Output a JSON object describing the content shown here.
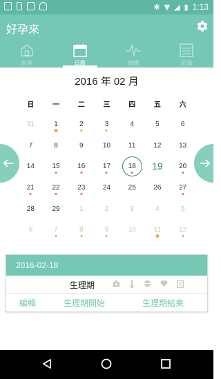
{
  "app": {
    "title": "好孕來"
  },
  "status": {
    "time": "1:13"
  },
  "tabs": [
    {
      "label": "首頁",
      "icon": "home-icon"
    },
    {
      "label": "日曆",
      "icon": "calendar-icon"
    },
    {
      "label": "曲線",
      "icon": "chart-line-icon"
    },
    {
      "label": "紀錄",
      "icon": "record-list-icon"
    }
  ],
  "calendar": {
    "title": "2016 年 02 月",
    "weekdays": [
      "日",
      "一",
      "二",
      "三",
      "四",
      "五",
      "六"
    ],
    "days": [
      {
        "d": "31",
        "other": true,
        "dot": "none"
      },
      {
        "d": "1",
        "other": false,
        "dot": "yellow-big"
      },
      {
        "d": "2",
        "other": false,
        "dot": "yellow"
      },
      {
        "d": "3",
        "other": false,
        "dot": "yellow"
      },
      {
        "d": "4",
        "other": false,
        "dot": "none"
      },
      {
        "d": "5",
        "other": false,
        "dot": "none"
      },
      {
        "d": "6",
        "other": false,
        "dot": "none"
      },
      {
        "d": "7",
        "other": false,
        "dot": "none"
      },
      {
        "d": "8",
        "other": false,
        "dot": "none"
      },
      {
        "d": "9",
        "other": false,
        "dot": "none"
      },
      {
        "d": "10",
        "other": false,
        "dot": "none"
      },
      {
        "d": "11",
        "other": false,
        "dot": "none"
      },
      {
        "d": "12",
        "other": false,
        "dot": "none"
      },
      {
        "d": "13",
        "other": false,
        "dot": "none"
      },
      {
        "d": "14",
        "other": false,
        "dot": "none"
      },
      {
        "d": "15",
        "other": false,
        "dot": "red"
      },
      {
        "d": "16",
        "other": false,
        "dot": "red"
      },
      {
        "d": "17",
        "other": false,
        "dot": "red"
      },
      {
        "d": "18",
        "other": false,
        "dot": "red",
        "selected": true
      },
      {
        "d": "19",
        "other": false,
        "dot": "none",
        "today": true
      },
      {
        "d": "20",
        "other": false,
        "dot": "red"
      },
      {
        "d": "21",
        "other": false,
        "dot": "red"
      },
      {
        "d": "22",
        "other": false,
        "dot": "red"
      },
      {
        "d": "23",
        "other": false,
        "dot": "red"
      },
      {
        "d": "24",
        "other": false,
        "dot": "none"
      },
      {
        "d": "25",
        "other": false,
        "dot": "none"
      },
      {
        "d": "26",
        "other": false,
        "dot": "none"
      },
      {
        "d": "27",
        "other": false,
        "dot": "red"
      },
      {
        "d": "28",
        "other": false,
        "dot": "none"
      },
      {
        "d": "29",
        "other": false,
        "dot": "none"
      },
      {
        "d": "1",
        "other": true,
        "dot": "none"
      },
      {
        "d": "2",
        "other": true,
        "dot": "none"
      },
      {
        "d": "3",
        "other": true,
        "dot": "none"
      },
      {
        "d": "4",
        "other": true,
        "dot": "none"
      },
      {
        "d": "5",
        "other": true,
        "dot": "none"
      },
      {
        "d": "6",
        "other": true,
        "dot": "none"
      },
      {
        "d": "7",
        "other": true,
        "dot": "yellow"
      },
      {
        "d": "8",
        "other": true,
        "dot": "yellow"
      },
      {
        "d": "9",
        "other": true,
        "dot": "yellow"
      },
      {
        "d": "10",
        "other": true,
        "dot": "none"
      },
      {
        "d": "11",
        "other": true,
        "dot": "yellow-big"
      },
      {
        "d": "12",
        "other": true,
        "dot": "yellow"
      }
    ]
  },
  "detail": {
    "date": "2016-02-18",
    "status": "生理期",
    "icons": [
      "medical-kit-icon",
      "thermometer-icon",
      "pill-icon",
      "heart-icon",
      "clipboard-icon"
    ],
    "edit": "編輯",
    "period_start": "生理期開始",
    "period_end": "生理期結束"
  },
  "colors": {
    "primary": "#74c8b4",
    "status_bar": "#5fb8a3",
    "accent_dark": "#2d8a78",
    "period_dot": "#e66a7a",
    "fertile_dot": "#f0a93a"
  }
}
